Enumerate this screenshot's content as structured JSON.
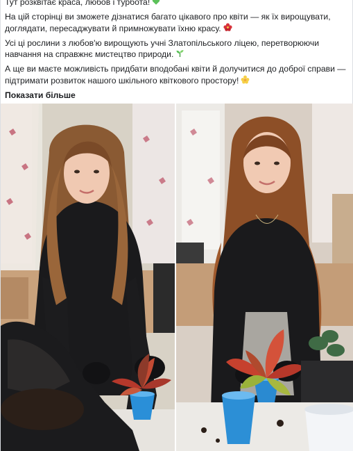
{
  "post": {
    "paragraphs": [
      {
        "text": "Тут розквітає краса, любов і турбота!",
        "emoji": "green-heart-icon"
      },
      {
        "text": "На цій сторінці ви зможете дізнатися багато цікавого про квіти — як їх вирощувати, доглядати, пересаджувати й примножувати їхню красу.",
        "emoji": "hibiscus-icon"
      },
      {
        "text": "Усі ці рослини з любов'ю вирощують учні Златопільського ліцею, перетворюючи навчання на справжнє мистецтво природи.",
        "emoji": "seedling-icon"
      },
      {
        "text": "А ще ви маєте можливість придбати вподобані квіти й долучитися до доброї справи — підтримати розвиток нашого шкільного квіткового простору!",
        "emoji": "blossom-icon"
      }
    ],
    "show_more_label": "Показати більше"
  },
  "photos": [
    {
      "name": "photo-girl-repotting-plant-left"
    },
    {
      "name": "photo-girl-repotting-coleus-right"
    }
  ],
  "colors": {
    "text": "#1c1e21",
    "accent_green": "#5cc15a",
    "hibiscus_red": "#d8333c",
    "blossom_yellow": "#f6d046"
  }
}
